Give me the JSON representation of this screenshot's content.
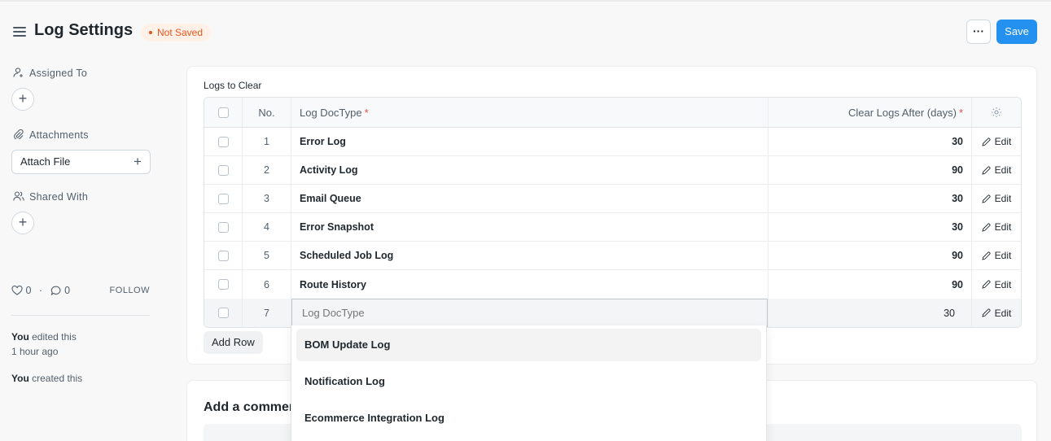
{
  "header": {
    "title": "Log Settings",
    "status": "Not Saved",
    "more_label": "···",
    "save_label": "Save"
  },
  "sidebar": {
    "assigned_to": "Assigned To",
    "attachments": "Attachments",
    "attach_file": "Attach File",
    "shared_with": "Shared With",
    "likes_count": "0",
    "comments_count": "0",
    "separator": "·",
    "follow": "FOLLOW",
    "activity": [
      {
        "user": "You",
        "action": " edited this",
        "time": "1 hour ago"
      },
      {
        "user": "You",
        "action": " created this",
        "time": ""
      }
    ]
  },
  "table": {
    "label": "Logs to Clear",
    "columns": {
      "no": "No.",
      "doctype": "Log DocType",
      "days": "Clear Logs After (days)",
      "required_mark": "*"
    },
    "edit_label": "Edit",
    "rows": [
      {
        "no": "1",
        "doctype": "Error Log",
        "days": "30"
      },
      {
        "no": "2",
        "doctype": "Activity Log",
        "days": "90"
      },
      {
        "no": "3",
        "doctype": "Email Queue",
        "days": "30"
      },
      {
        "no": "4",
        "doctype": "Error Snapshot",
        "days": "30"
      },
      {
        "no": "5",
        "doctype": "Scheduled Job Log",
        "days": "90"
      },
      {
        "no": "6",
        "doctype": "Route History",
        "days": "90"
      }
    ],
    "editing_row": {
      "no": "7",
      "placeholder": "Log DocType",
      "days": "30"
    },
    "add_row": "Add Row"
  },
  "comment": {
    "title": "Add a comment"
  },
  "dropdown": {
    "options": [
      "BOM Update Log",
      "Notification Log",
      "Ecommerce Integration Log"
    ]
  }
}
